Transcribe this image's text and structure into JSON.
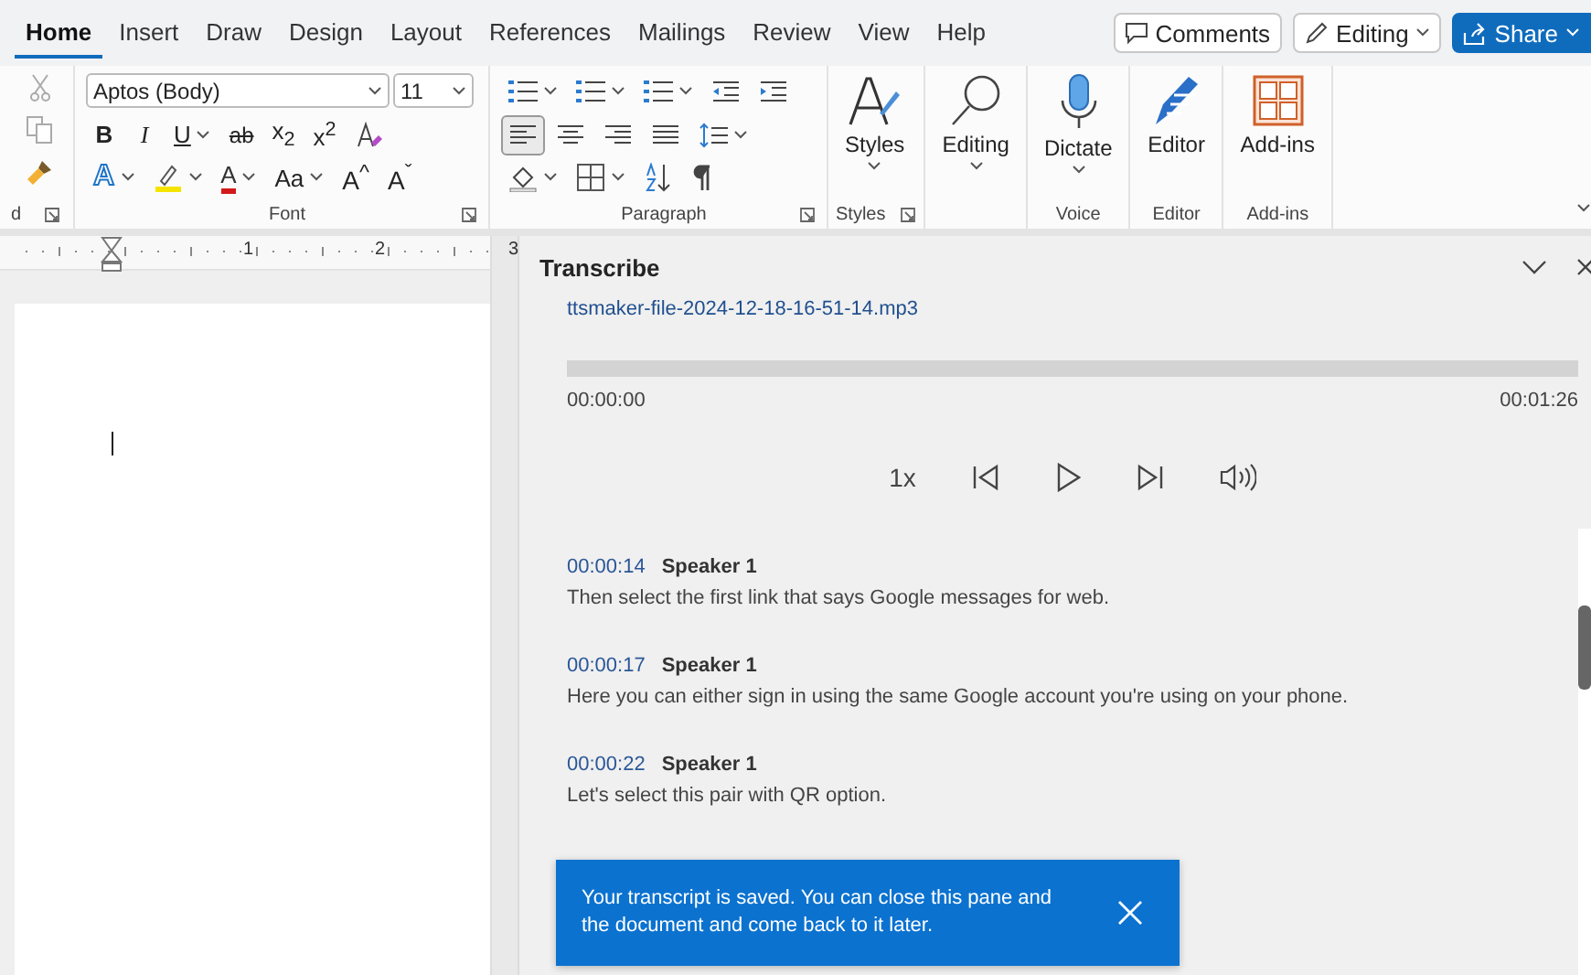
{
  "tabs": [
    {
      "label": "Home",
      "selected": true
    },
    {
      "label": "Insert",
      "selected": false
    },
    {
      "label": "Draw",
      "selected": false
    },
    {
      "label": "Design",
      "selected": false
    },
    {
      "label": "Layout",
      "selected": false
    },
    {
      "label": "References",
      "selected": false
    },
    {
      "label": "Mailings",
      "selected": false
    },
    {
      "label": "Review",
      "selected": false
    },
    {
      "label": "View",
      "selected": false
    },
    {
      "label": "Help",
      "selected": false
    }
  ],
  "header_buttons": [
    {
      "kind": "comments",
      "label": "Comments"
    },
    {
      "kind": "editing",
      "label": "Editing"
    },
    {
      "kind": "share",
      "label": "Share"
    }
  ],
  "clipboard": {
    "label": "d"
  },
  "font": {
    "name": "Aptos (Body)",
    "size": "11",
    "label": "Font",
    "row1": [
      {
        "kind": "bold",
        "label": "B",
        "dropdown": false
      },
      {
        "kind": "italic",
        "label": "I",
        "dropdown": false
      },
      {
        "kind": "underline",
        "label": "U",
        "dropdown": true
      },
      {
        "kind": "strikethrough",
        "label": "ab",
        "dropdown": false
      },
      {
        "kind": "subscript",
        "label": "x$_{2}$",
        "dropdown": false
      },
      {
        "kind": "superscript",
        "label": "x$^{2}$",
        "dropdown": false
      },
      {
        "kind": "clear-format",
        "dropdown": false
      }
    ],
    "row2": [
      {
        "kind": "text-effects",
        "label": "A",
        "dropdown": true
      },
      {
        "kind": "highlight",
        "dropdown": true
      },
      {
        "kind": "font-color",
        "label": "A",
        "dropdown": true
      },
      {
        "kind": "change-case",
        "label": "Aa",
        "dropdown": true
      },
      {
        "kind": "grow-font",
        "label": "A$^{^}$",
        "dropdown": false
      },
      {
        "kind": "shrink-font",
        "label": "A$^{ˇ}$",
        "dropdown": false
      }
    ]
  },
  "paragraph": {
    "label": "Paragraph",
    "row1": [
      {
        "kind": "bullets",
        "dropdown": true
      },
      {
        "kind": "numbering",
        "dropdown": true
      },
      {
        "kind": "multilevel",
        "dropdown": true
      },
      {
        "kind": "outdent",
        "dropdown": false
      },
      {
        "kind": "indent",
        "dropdown": false
      }
    ],
    "align": [
      {
        "kind": "left",
        "selected": true
      },
      {
        "kind": "center",
        "selected": false
      },
      {
        "kind": "right",
        "selected": false
      },
      {
        "kind": "justify",
        "selected": false
      }
    ],
    "row3": [
      {
        "kind": "shading",
        "dropdown": true
      },
      {
        "kind": "borders",
        "dropdown": true
      },
      {
        "kind": "sort",
        "dropdown": false
      },
      {
        "kind": "pilcrow",
        "dropdown": false
      }
    ]
  },
  "big_groups": [
    {
      "label": "Styles",
      "launcher": true,
      "buttons": [
        {
          "kind": "styles",
          "label": "Styles",
          "dropdown": true
        }
      ]
    },
    {
      "launcher": false,
      "buttons": [
        {
          "kind": "editing",
          "label": "Editing",
          "dropdown": true
        }
      ]
    },
    {
      "label": "Voice",
      "launcher": false,
      "buttons": [
        {
          "kind": "dictate",
          "label": "Dictate",
          "dropdown": true
        }
      ]
    },
    {
      "label": "Editor",
      "launcher": false,
      "buttons": [
        {
          "kind": "editor",
          "label": "Editor",
          "dropdown": false
        }
      ]
    },
    {
      "label": "Add-ins",
      "launcher": false,
      "buttons": [
        {
          "kind": "addins",
          "label": "Add-ins",
          "dropdown": false
        }
      ]
    }
  ],
  "ruler": {
    "numbers": [
      "1",
      "2",
      "3"
    ]
  },
  "pane": {
    "title": "Transcribe",
    "file": "ttsmaker-file-2024-12-18-16-51-14.mp3",
    "progress": {
      "level": 0
    },
    "start": "00:00:00",
    "end": "00:01:26",
    "speed": "1x",
    "entries": [
      {
        "time": "00:00:14",
        "speaker": "Speaker 1",
        "text": "Then select the first link that says Google messages for web."
      },
      {
        "time": "00:00:17",
        "speaker": "Speaker 1",
        "text": "Here you can either sign in using the same Google account you're using on your phone."
      },
      {
        "time": "00:00:22",
        "speaker": "Speaker 1",
        "text": "Let's select this pair with QR option."
      }
    ],
    "toast": {
      "text": "Your transcript is saved. You can close this pane and the document and come back to it later."
    }
  }
}
